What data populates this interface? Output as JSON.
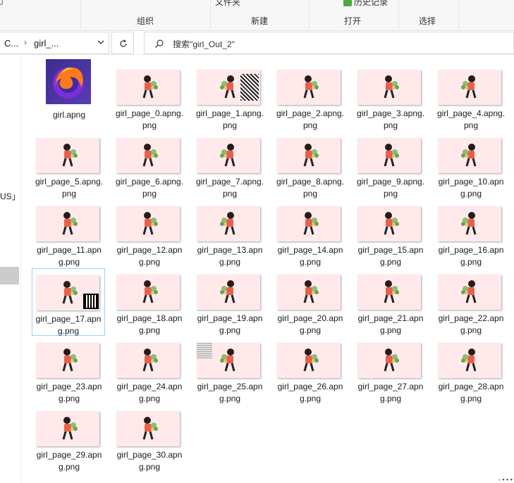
{
  "ribbon": {
    "clipped_top": [
      "文件夹",
      "历史记录"
    ],
    "groups": [
      "组织",
      "新建",
      "打开",
      "选择"
    ]
  },
  "address": {
    "crumbs": [
      "C...",
      "girl_..."
    ],
    "search_placeholder": "搜索\"girl_Out_2\""
  },
  "nav": {
    "fragment": "US」"
  },
  "files": {
    "first": "girl.apng",
    "items": [
      "girl_page_0.apng.png",
      "girl_page_1.apng.png",
      "girl_page_2.apng.png",
      "girl_page_3.apng.png",
      "girl_page_4.apng.png",
      "girl_page_5.apng.png",
      "girl_page_6.apng.png",
      "girl_page_7.apng.png",
      "girl_page_8.apng.png",
      "girl_page_9.apng.png",
      "girl_page_10.apng.png",
      "girl_page_11.apng.png",
      "girl_page_12.apng.png",
      "girl_page_13.apng.png",
      "girl_page_14.apng.png",
      "girl_page_15.apng.png",
      "girl_page_16.apng.png",
      "girl_page_17.apng.png",
      "girl_page_18.apng.png",
      "girl_page_19.apng.png",
      "girl_page_20.apng.png",
      "girl_page_21.apng.png",
      "girl_page_22.apng.png",
      "girl_page_23.apng.png",
      "girl_page_24.apng.png",
      "girl_page_25.apng.png",
      "girl_page_26.apng.png",
      "girl_page_27.apng.png",
      "girl_page_28.apng.png",
      "girl_page_29.apng.png",
      "girl_page_30.apng.png"
    ],
    "selected": "girl_page_17.apng.png"
  },
  "status": {
    "corner": "▫ ▪ ▪ ▪"
  },
  "colors": {
    "thumb_bg": "#ffe9ea",
    "selection_border": "#99d1ff"
  }
}
